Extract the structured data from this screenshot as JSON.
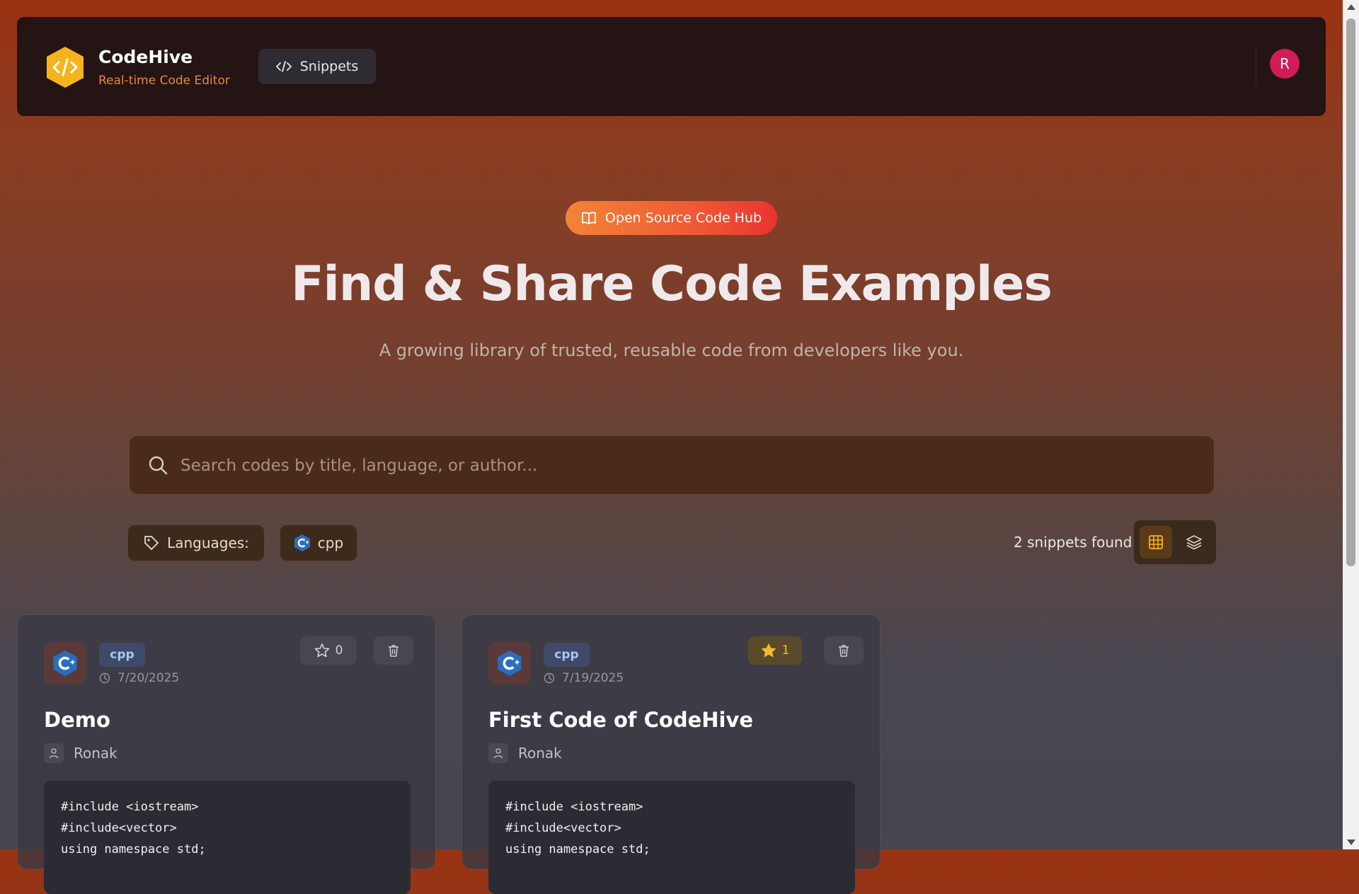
{
  "header": {
    "brand_name": "CodeHive",
    "brand_subtitle": "Real-time Code Editor",
    "nav_label": "Snippets",
    "avatar_initial": "R"
  },
  "hero": {
    "badge": "Open Source Code Hub",
    "title": "Find & Share Code Examples",
    "subtitle": "A growing library of trusted, reusable code from developers like you."
  },
  "search": {
    "placeholder": "Search codes by title, language, or author...",
    "value": ""
  },
  "filters": {
    "languages_label": "Languages:",
    "language_chips": [
      "cpp"
    ]
  },
  "results": {
    "count_text": "2 snippets found"
  },
  "cards": [
    {
      "language": "cpp",
      "date": "7/20/2025",
      "stars": "0",
      "starred": false,
      "title": "Demo",
      "author": "Ronak",
      "code": "#include <iostream>\n#include<vector>\nusing namespace std;"
    },
    {
      "language": "cpp",
      "date": "7/19/2025",
      "stars": "1",
      "starred": true,
      "title": "First Code of CodeHive",
      "author": "Ronak",
      "code": "#include <iostream>\n#include<vector>\nusing namespace std;"
    }
  ],
  "colors": {
    "accent_orange": "#f28437",
    "accent_red": "#e9342f",
    "star_gold": "#f2bd28",
    "avatar": "#d01c58",
    "logo_amber": "#f5b41c"
  }
}
